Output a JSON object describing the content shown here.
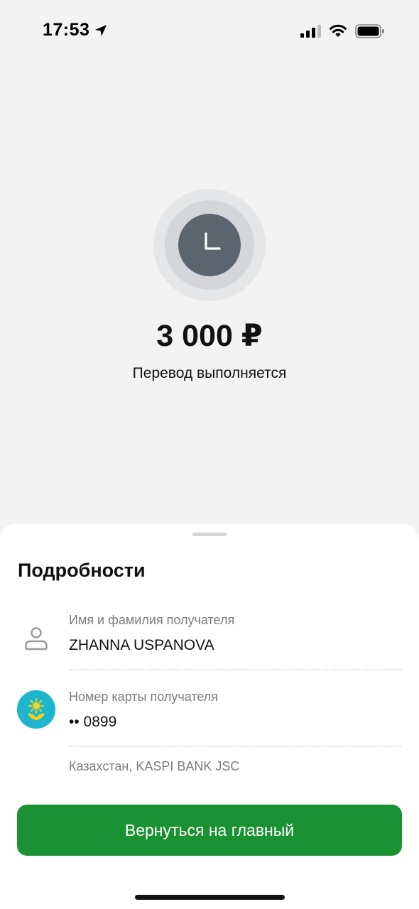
{
  "status_bar": {
    "time": "17:53",
    "icons": [
      "location-arrow-icon",
      "cellular-signal-icon",
      "wifi-icon",
      "battery-icon"
    ]
  },
  "transfer": {
    "status_icon": "clock-icon",
    "amount": "3 000 ₽",
    "status_text": "Перевод выполняется"
  },
  "details": {
    "title": "Подробности",
    "recipient_name_label": "Имя и фамилия получателя",
    "recipient_name": "ZHANNA USPANOVA",
    "card_number_label": "Номер карты получателя",
    "card_number": "•• 0899",
    "bank_info": "Казахстан, KASPI BANK JSC"
  },
  "actions": {
    "home_button_label": "Вернуться на главный"
  },
  "colors": {
    "background": "#f3f3f3",
    "sheet": "#ffffff",
    "status_circle": "#5c6470",
    "primary_button": "#1a9132",
    "bank_logo": "#1db6cc"
  }
}
